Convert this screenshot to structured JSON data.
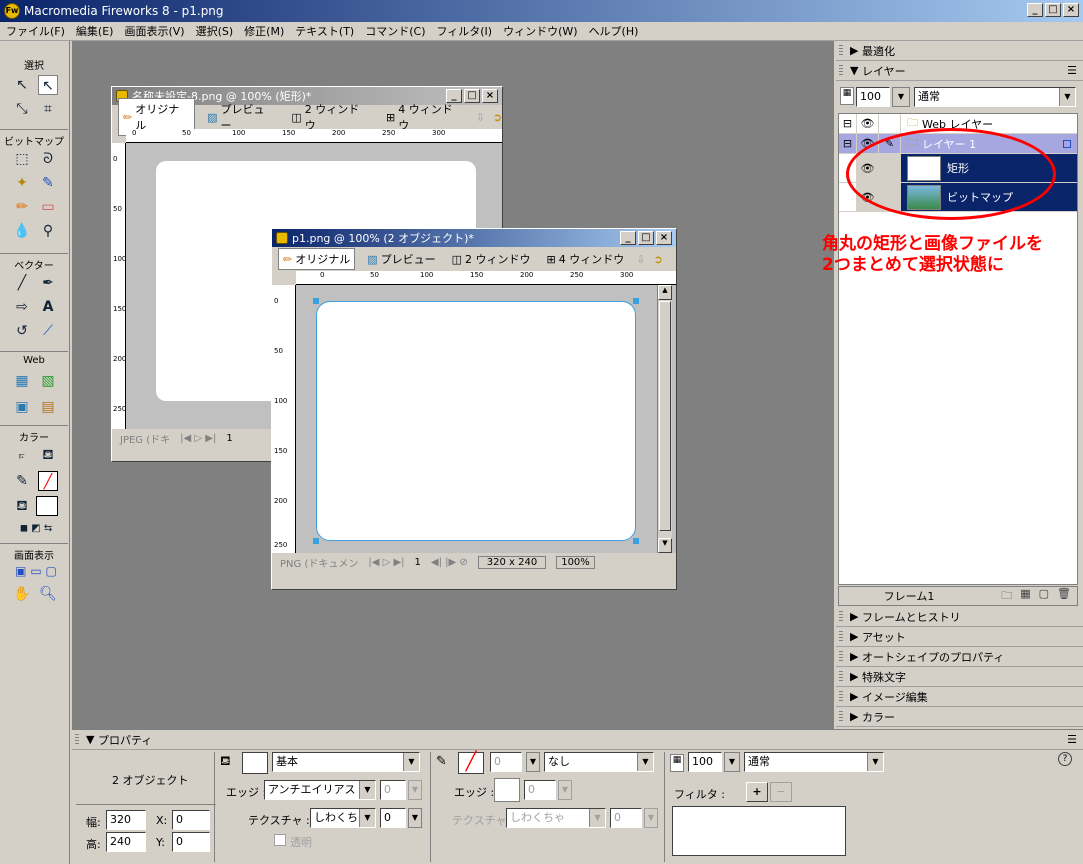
{
  "window": {
    "title": "Macromedia Fireworks 8 - p1.png"
  },
  "menu": [
    "ファイル(F)",
    "編集(E)",
    "画面表示(V)",
    "選択(S)",
    "修正(M)",
    "テキスト(T)",
    "コマンド(C)",
    "フィルタ(I)",
    "ウィンドウ(W)",
    "ヘルプ(H)"
  ],
  "tools": {
    "select": "選択",
    "bitmap": "ビットマップ",
    "vector": "ベクター",
    "web": "Web",
    "color": "カラー",
    "view": "画面表示"
  },
  "doc1": {
    "title": "名称未設定-8.png @ 100% (矩形)*",
    "tabs": [
      "オリジナル",
      "プレビュー",
      "2 ウィンドウ",
      "4 ウィンドウ"
    ],
    "status": "JPEG (ドキ",
    "page": "1",
    "ruler_labels": [
      "0",
      "50",
      "100",
      "150",
      "200",
      "250",
      "300"
    ],
    "vruler_labels": [
      "0",
      "50",
      "100",
      "150",
      "200",
      "250"
    ]
  },
  "doc2": {
    "title": "p1.png @ 100% (2 オブジェクト)*",
    "tabs": [
      "オリジナル",
      "プレビュー",
      "2 ウィンドウ",
      "4 ウィンドウ"
    ],
    "status": "PNG (ドキュメン",
    "page": "1",
    "size": "320 x 240",
    "zoom": "100%",
    "ruler_labels": [
      "0",
      "50",
      "100",
      "150",
      "200",
      "250",
      "300"
    ],
    "vruler_labels": [
      "0",
      "50",
      "100",
      "150",
      "200",
      "250"
    ]
  },
  "panels": {
    "optimize": "最適化",
    "layers": "レイヤー",
    "opacity": "100",
    "blend": "通常",
    "web_layer": "Web レイヤー",
    "layer1": "レイヤー 1",
    "obj1": "矩形",
    "obj2": "ビットマップ",
    "frame": "フレーム1",
    "collapsed": [
      "フレームとヒストリ",
      "アセット",
      "オートシェイプのプロパティ",
      "特殊文字",
      "イメージ編集",
      "カラー"
    ]
  },
  "annotation": [
    "角丸の矩形と画像ファイルを",
    "2つまとめて選択状態に"
  ],
  "props": {
    "title": "プロパティ",
    "selection": "2 オブジェクト",
    "width_label": "幅:",
    "width": "320",
    "height_label": "高:",
    "height": "240",
    "x_label": "X:",
    "x": "0",
    "y_label": "Y:",
    "y": "0",
    "fill_type": "基本",
    "edge_label": "エッジ :",
    "edge": "アンチエイリアス",
    "edge_val": "0",
    "texture_label": "テクスチャ :",
    "texture": "しわくちゃ",
    "texture_val": "0",
    "transparent": "透明",
    "stroke_size": "0",
    "stroke_type": "なし",
    "stroke_edge_label": "エッジ :",
    "stroke_edge": "0",
    "stroke_texture_label": "テクスチャ :",
    "stroke_texture": "しわくちゃ",
    "stroke_texture_val": "0",
    "opacity": "100",
    "blend": "通常",
    "filter_label": "フィルタ :"
  }
}
